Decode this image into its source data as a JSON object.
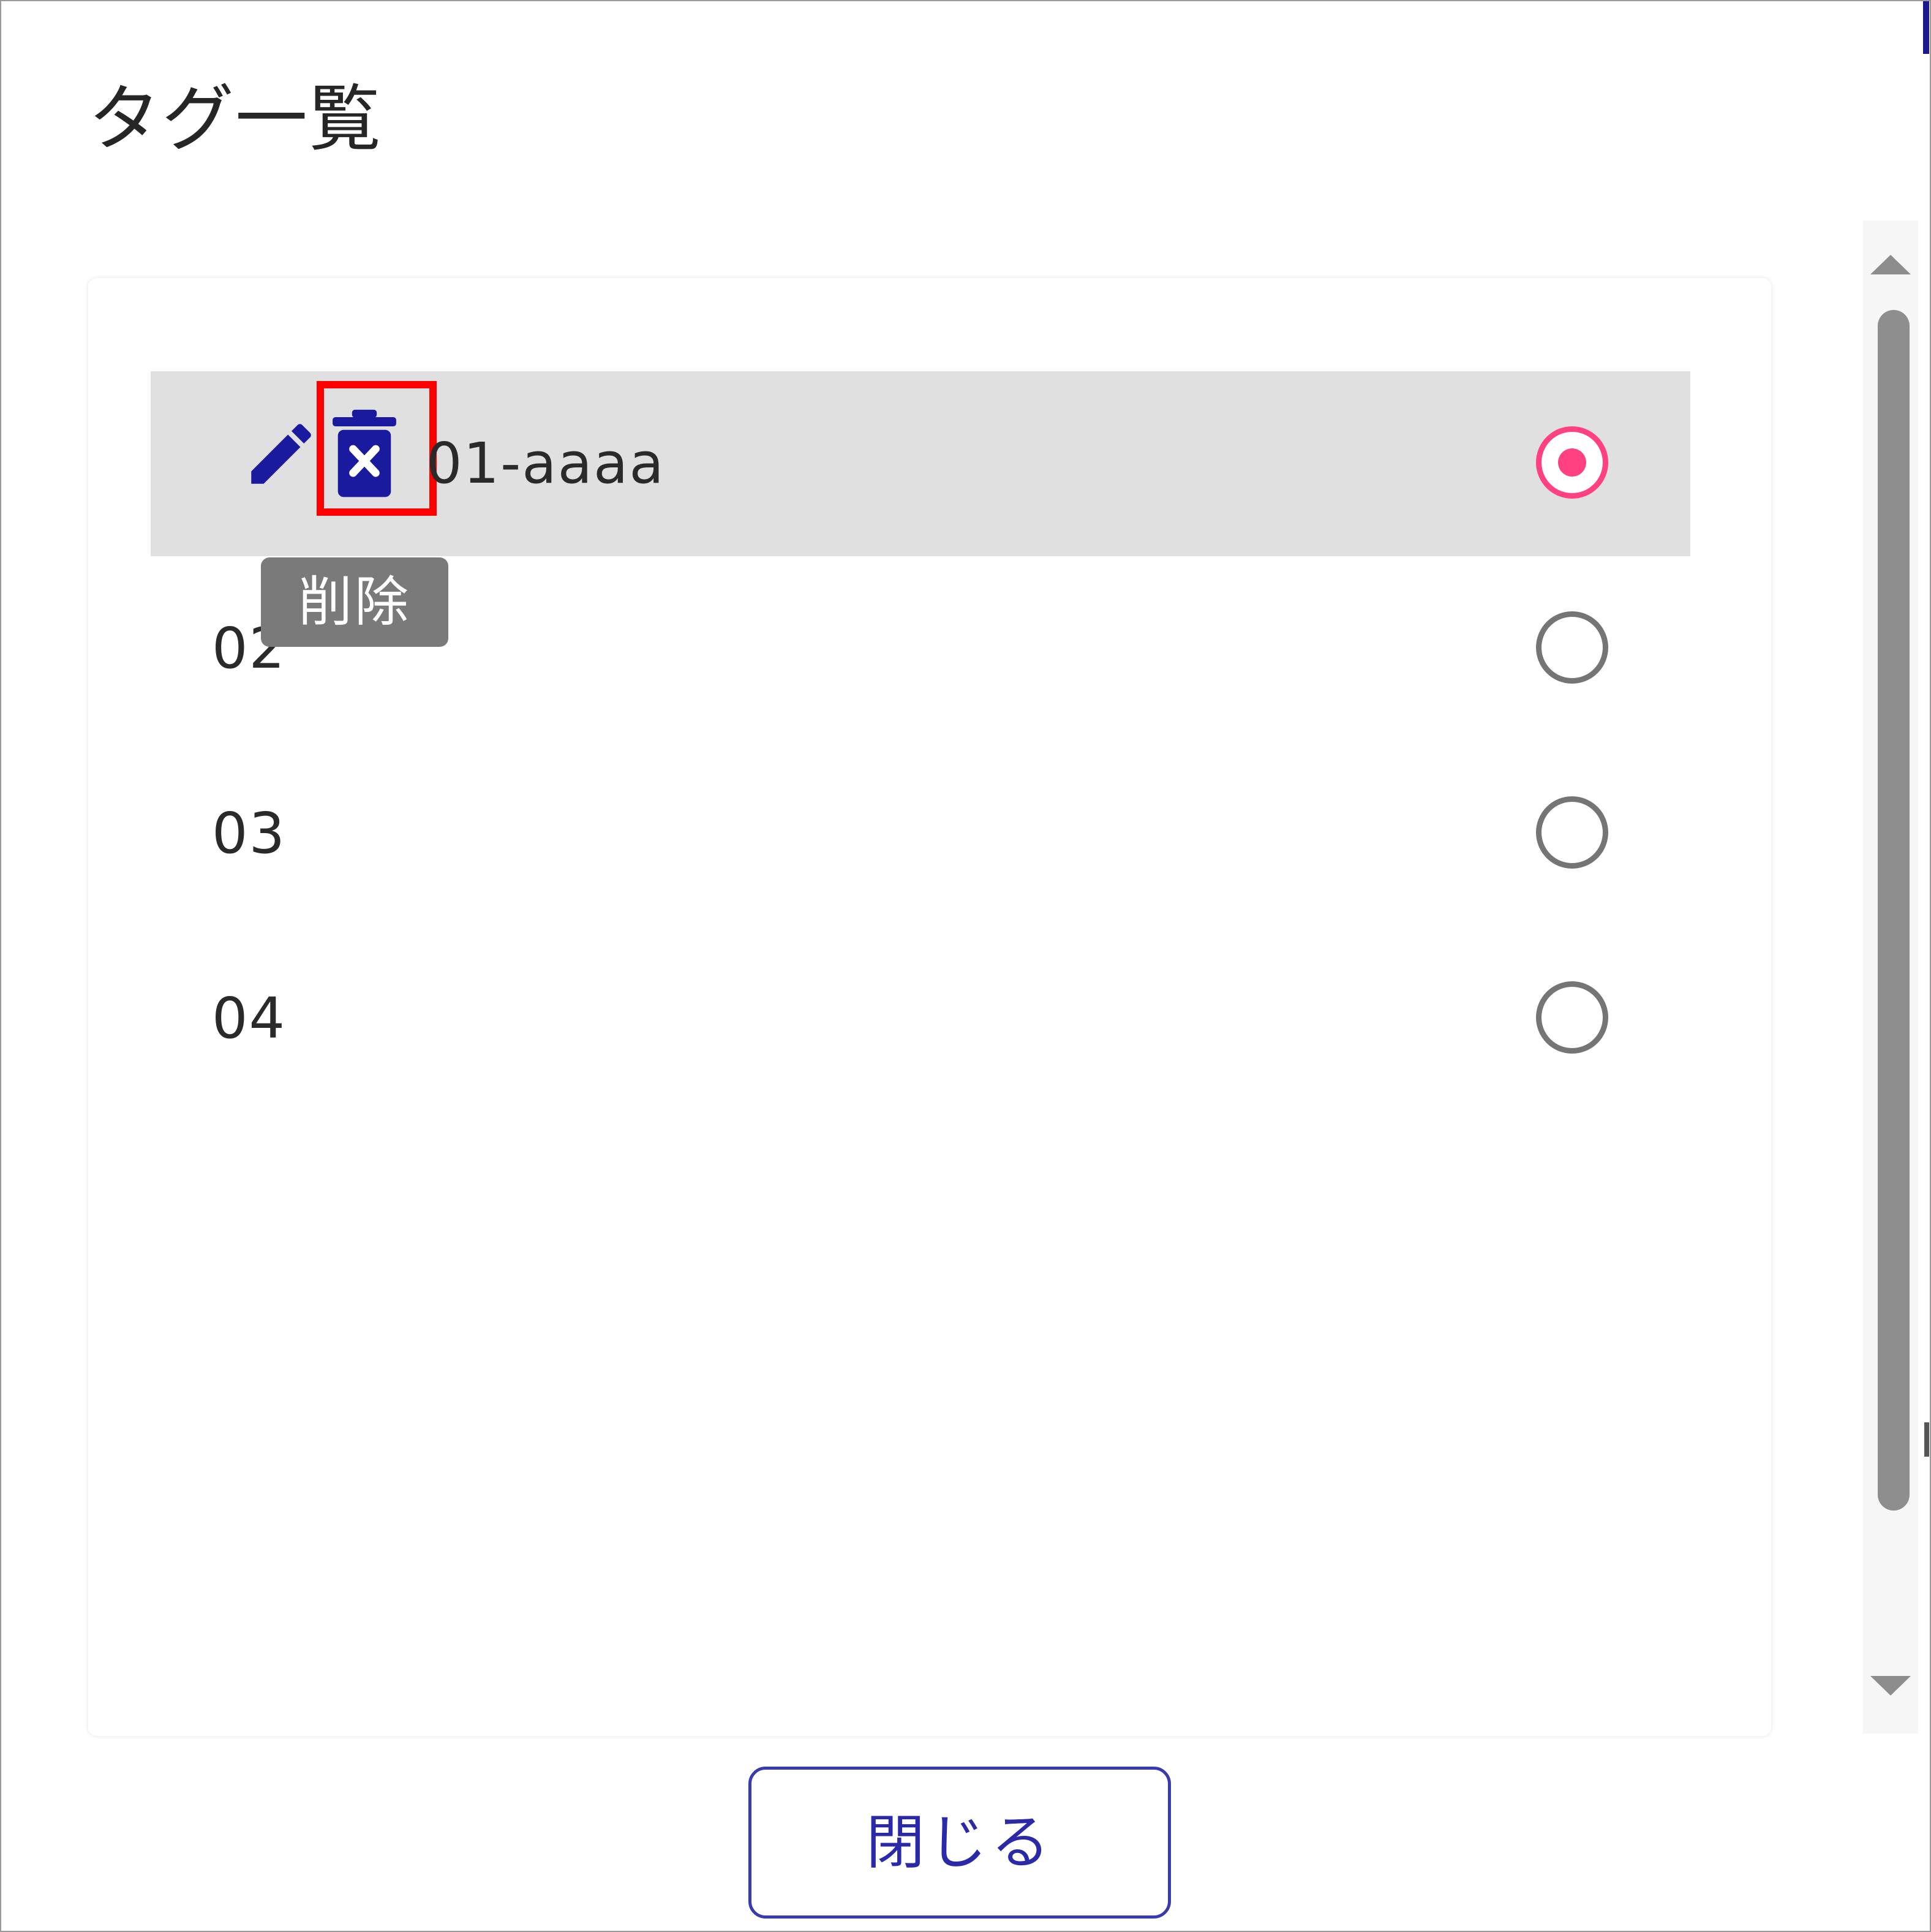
{
  "dialog": {
    "title": "タグ一覧",
    "close_label": "閉じる"
  },
  "tags": [
    {
      "label": "01-aaaa",
      "selected": true
    },
    {
      "label": "02",
      "selected": false
    },
    {
      "label": "03",
      "selected": false
    },
    {
      "label": "04",
      "selected": false
    }
  ],
  "tooltip": {
    "text": "削除"
  },
  "icons": {
    "edit": "pencil-icon",
    "delete": "trash-x-icon",
    "scroll_up": "triangle-up-icon",
    "scroll_down": "triangle-down-icon"
  },
  "colors": {
    "icon_blue": "#1a1a9e",
    "radio_selected": "#ff4081",
    "highlight_red": "#ff0000",
    "button_text": "#2a2aa8"
  }
}
